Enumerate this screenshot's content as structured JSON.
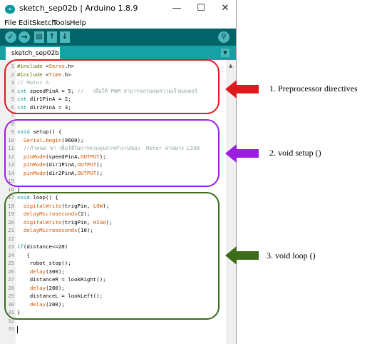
{
  "window": {
    "title": "sketch_sep02b | Arduino 1.8.9",
    "app_icon_text": "∞",
    "controls": {
      "minimize": "—",
      "maximize": "☐",
      "close": "✕"
    }
  },
  "menu": [
    "File",
    "Edit",
    "Sketch",
    "Tools",
    "Help"
  ],
  "toolbar": {
    "verify_icon": "✓",
    "upload_icon": "→",
    "new_icon": "▤",
    "open_icon": "↑",
    "save_icon": "↓",
    "serial_monitor_icon": "⚲"
  },
  "tab": {
    "label": "sketch_sep02b §",
    "menu_icon": "▼"
  },
  "code_lines": [
    {
      "n": "1",
      "t": "#include <Servo.h>"
    },
    {
      "n": "2",
      "t": "#include <Time.h>"
    },
    {
      "n": "3",
      "t": "// Motor A"
    },
    {
      "n": "4",
      "t": "int speedPinA = 5; //   เพื่อให้ PWM สามารถควบคุมความเร็วมอเตอร์"
    },
    {
      "n": "5",
      "t": "int dir1PinA = 2;"
    },
    {
      "n": "6",
      "t": "int dir2PinA = 3;"
    },
    {
      "n": "7",
      "t": ""
    },
    {
      "n": "8",
      "t": ""
    },
    {
      "n": "9",
      "t": "void setup() {"
    },
    {
      "n": "10",
      "t": "  Serial.begin(9600);"
    },
    {
      "n": "11",
      "t": "  //กำหนด ขา เพื่อใช้ในการควบคุมการทำงานของ  Motor ผ่านทาง L298"
    },
    {
      "n": "12",
      "t": "  pinMode(speedPinA,OUTPUT);"
    },
    {
      "n": "13",
      "t": "  pinMode(dir1PinA,OUTPUT);"
    },
    {
      "n": "14",
      "t": "  pinMode(dir2PinA,OUTPUT);"
    },
    {
      "n": "15",
      "t": ""
    },
    {
      "n": "16",
      "t": "}"
    },
    {
      "n": "17",
      "t": "void loop() {"
    },
    {
      "n": "18",
      "t": "  digitalWrite(trigPin, LOW);"
    },
    {
      "n": "19",
      "t": "  delayMicroseconds(2);"
    },
    {
      "n": "20",
      "t": "  digitalWrite(trigPin, HIGH);"
    },
    {
      "n": "21",
      "t": "  delayMicroseconds(10);"
    },
    {
      "n": "22",
      "t": ""
    },
    {
      "n": "23",
      "t": "if(distance<=20)"
    },
    {
      "n": "24",
      "t": "   {"
    },
    {
      "n": "25",
      "t": "    robot_stop();"
    },
    {
      "n": "26",
      "t": "    delay(300);"
    },
    {
      "n": "27",
      "t": "    distanceR = lookRight();"
    },
    {
      "n": "28",
      "t": "    delay(200);"
    },
    {
      "n": "29",
      "t": "    distanceL = lookLeft();"
    },
    {
      "n": "30",
      "t": "    delay(200);"
    },
    {
      "n": "31",
      "t": "}"
    },
    {
      "n": "32",
      "t": ""
    },
    {
      "n": "33",
      "t": ""
    }
  ],
  "annotations": [
    {
      "label": "1. Preprocessor directives",
      "color": "#e0191f"
    },
    {
      "label": "2. void setup ()",
      "color": "#9b1ee0"
    },
    {
      "label": "3. void loop ()",
      "color": "#3c6b1a"
    }
  ],
  "colors": {
    "toolbar_bg": "#006468",
    "tabbar_bg": "#17a1a5",
    "button_bg": "#4db7bb",
    "keyword": "#00979c",
    "function": "#d35400",
    "comment": "#95a5a6"
  }
}
